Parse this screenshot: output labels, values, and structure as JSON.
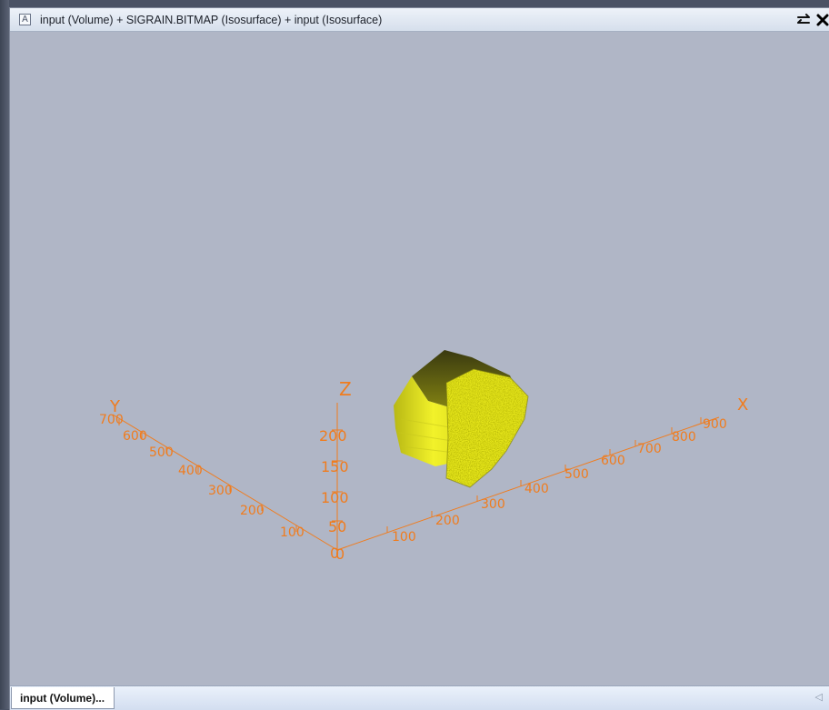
{
  "window": {
    "icon": "A",
    "title": "input (Volume) + SIGRAIN.BITMAP (Isosurface) + input (Isosurface)",
    "pin_icon": "pin-toggle-icon",
    "close_icon": "close-icon"
  },
  "viewport": {
    "background": "#b0b6c6",
    "axis_color": "#f07c1e",
    "object_color": "#e6e61e",
    "axes": {
      "x": {
        "label": "X",
        "ticks": [
          "100",
          "200",
          "300",
          "400",
          "500",
          "600",
          "700",
          "800",
          "900"
        ]
      },
      "y": {
        "label": "Y",
        "ticks": [
          "100",
          "200",
          "300",
          "400",
          "500",
          "600",
          "700"
        ]
      },
      "z": {
        "label": "Z",
        "ticks": [
          "50",
          "100",
          "150",
          "200"
        ]
      },
      "origin": [
        "0",
        "0"
      ]
    }
  },
  "bottom_tabs": [
    {
      "label": "input (Volume)..."
    }
  ],
  "scroll_arrow": "◁"
}
